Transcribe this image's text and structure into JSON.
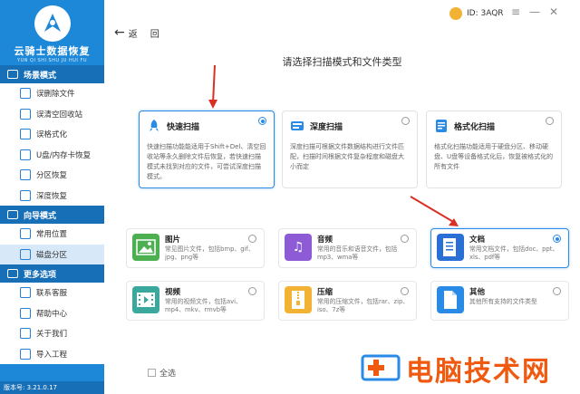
{
  "app": {
    "logo_title": "云骑士数据恢复",
    "logo_sub": "YUN QI SHI SHU JU HUI FU",
    "version": "版本号: 3.21.0.17",
    "accent": "#1e88d8"
  },
  "header": {
    "back_label": "返",
    "back_label2": "回",
    "user_id": "ID: 3AQR",
    "heading": "请选择扫描模式和文件类型"
  },
  "sidebar": {
    "sections": [
      {
        "title": "场景模式",
        "items": [
          "误删除文件",
          "误清空回收站",
          "误格式化",
          "U盘/内存卡恢复",
          "分区恢复",
          "深度恢复"
        ]
      },
      {
        "title": "向导模式",
        "items": [
          "常用位置",
          "磁盘分区"
        ]
      },
      {
        "title": "更多选项",
        "items": [
          "联系客服",
          "帮助中心",
          "关于我们",
          "导入工程"
        ]
      }
    ]
  },
  "scan_modes": [
    {
      "title": "快速扫描",
      "desc": "快速扫描功能能适用于Shift+Del、清空回收站等永久删除文件后恢复，若快速扫描模式未找到对应的文件，可尝试深度扫描模式。",
      "selected": true
    },
    {
      "title": "深度扫描",
      "desc": "深度扫描可根据文件数据结构进行文件匹配，扫描时间根据文件复杂程度和磁盘大小而定",
      "selected": false
    },
    {
      "title": "格式化扫描",
      "desc": "格式化扫描功能适用于硬盘分区、移动硬盘、U盘等设备格式化后，恢复被格式化的所有文件",
      "selected": false
    }
  ],
  "file_types": [
    {
      "title": "图片",
      "desc": "常见图片文件，包括bmp、gif、jpg、png等",
      "selected": false
    },
    {
      "title": "音频",
      "desc": "常用的音乐和语音文件，包括mp3、wma等",
      "selected": false
    },
    {
      "title": "文档",
      "desc": "常用文档文件，包括doc、ppt、xls、pdf等",
      "selected": true
    },
    {
      "title": "视频",
      "desc": "常用的视频文件，包括avi、mp4、mkv、rmvb等",
      "selected": false
    },
    {
      "title": "压缩",
      "desc": "常用的压缩文件，包括rar、zip、iso、7z等",
      "selected": false
    },
    {
      "title": "其他",
      "desc": "其他所有支持的文件类型",
      "selected": false
    }
  ],
  "footer": {
    "select_all": "全选",
    "watermark": "电脑技术网"
  }
}
